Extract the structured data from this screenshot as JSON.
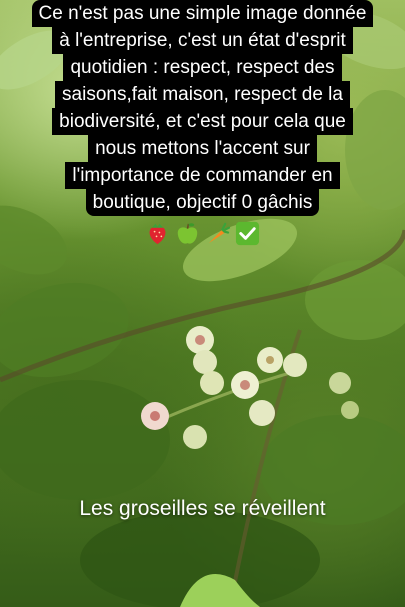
{
  "story": {
    "caption_lines": [
      "Ce n'est pas une simple image donnée",
      "à l'entreprise, c'est un état d'esprit",
      "quotidien  : respect, respect des",
      "saisons,fait maison, respect de la",
      "biodiversité, et c'est pour cela que",
      "nous mettons l'accent sur",
      "l'importance de commander en",
      "boutique, objectif 0 gâchis"
    ],
    "emojis": [
      "strawberry-icon",
      "green-apple-icon",
      "carrot-icon",
      "check-mark-button-icon"
    ],
    "overlay_text": "Les groseilles se réveillent"
  }
}
